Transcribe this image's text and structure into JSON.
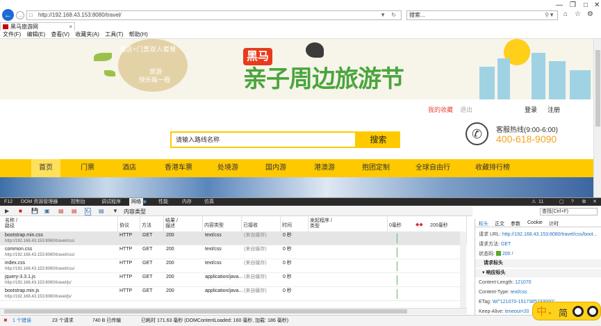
{
  "browser": {
    "address": "http://192.168.43.153:8080/travel/",
    "search_placeholder": "搜索...",
    "tab_title": "黑马旅游网",
    "menu": [
      "文件(F)",
      "编辑(E)",
      "查看(V)",
      "收藏夹(A)",
      "工具(T)",
      "帮助(H)"
    ]
  },
  "site": {
    "banner": {
      "promo_line1": "酒店+门票双人套餐",
      "promo_line2": "旅游",
      "promo_line3": "快乐每一程",
      "logo_badge": "黑马",
      "logo_text": "亲子周边旅游节"
    },
    "links": {
      "favorites": "我的收藏",
      "logout": "退出",
      "login": "登录",
      "register": "注册"
    },
    "search": {
      "placeholder": "请输入路线名称",
      "button": "搜索"
    },
    "hotline": {
      "label": "客服热线(9:00-6:00)",
      "number": "400-618-9090"
    },
    "nav": [
      "首页",
      "门票",
      "酒店",
      "香港车票",
      "处境游",
      "国内游",
      "港澳游",
      "抱团定制",
      "全球自由行",
      "收藏排行榜"
    ]
  },
  "devtools": {
    "f12": "F12",
    "tabs": [
      "DOM 资源管理器",
      "控制台",
      "调试程序",
      "网络",
      "性能",
      "内存",
      "仿真"
    ],
    "active_tab": "网络",
    "counter": "11",
    "filter_label": "内容类型",
    "find_placeholder": "查找(Ctrl+F)",
    "columns": {
      "name": "名称 /",
      "path": "路径",
      "protocol": "协议",
      "method": "方法",
      "result": "结果 /",
      "result2": "描述",
      "type": "内容类型",
      "received": "已接收",
      "time": "时间",
      "initiator": "发起程序 /",
      "initiator2": "类型",
      "t0": "0毫秒",
      "t200": "200毫秒"
    },
    "rows": [
      {
        "name": "bootstrap.min.css",
        "path": "http://192.168.43.153:8080/travel/css/",
        "protocol": "HTTP",
        "method": "GET",
        "result": "200",
        "type": "text/css",
        "received": "(来自缓存)",
        "time": "0 秒"
      },
      {
        "name": "common.css",
        "path": "http://192.168.43.153:8080/travel/css/",
        "protocol": "HTTP",
        "method": "GET",
        "result": "200",
        "type": "text/css",
        "received": "(来自缓存)",
        "time": "0 秒"
      },
      {
        "name": "index.css",
        "path": "http://192.168.43.153:8080/travel/css/",
        "protocol": "HTTP",
        "method": "GET",
        "result": "200",
        "type": "text/css",
        "received": "(来自缓存)",
        "time": "0 秒"
      },
      {
        "name": "jquery-3.3.1.js",
        "path": "http://192.168.43.153:8080/travel/js/",
        "protocol": "HTTP",
        "method": "GET",
        "result": "200",
        "type": "application/java...",
        "received": "(来自缓存)",
        "time": "0 秒"
      },
      {
        "name": "bootstrap.min.js",
        "path": "http://192.168.43.153:8080/travel/js/",
        "protocol": "HTTP",
        "method": "GET",
        "result": "200",
        "type": "application/java...",
        "received": "(来自缓存)",
        "time": "0 秒"
      }
    ],
    "details": {
      "tabs": [
        "标头",
        "正文",
        "参数",
        "Cookie",
        "计时"
      ],
      "request_url_label": "请求 URL:",
      "request_url": "http://192.168.43.153:8080/travel/css/boot...",
      "method_label": "请求方法:",
      "method": "GET",
      "status_label": "状态码:",
      "status": "200 /",
      "section_request": "请求标头",
      "section_response": "响应标头",
      "headers": [
        {
          "k": "Content-Length:",
          "v": "121070"
        },
        {
          "k": "Content-Type:",
          "v": "text/css"
        },
        {
          "k": "ETag:",
          "v": "W/\"121070-1517385233000\""
        },
        {
          "k": "Keep-Alive:",
          "v": "timeout=20"
        }
      ]
    },
    "status": {
      "errors": "1 个错误",
      "requests": "23 个请求",
      "transferred": "740 B 已传输",
      "timing": "已耗时 171.63 毫秒 (DOMContentLoaded: 160 毫秒, 加载: 186 毫秒)"
    }
  },
  "ime": {
    "mode": "中",
    "script": "简"
  }
}
